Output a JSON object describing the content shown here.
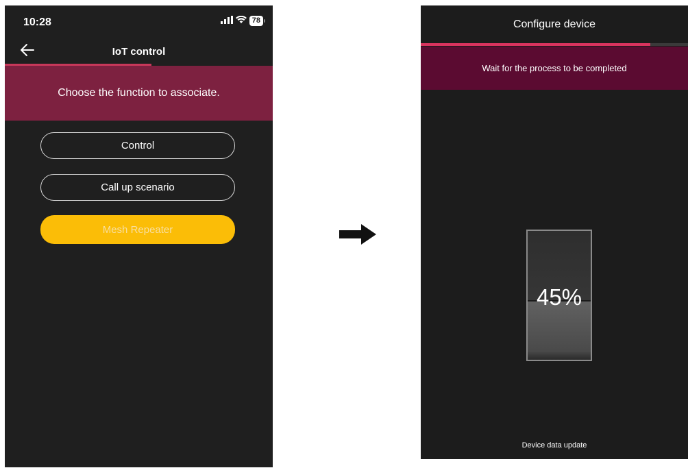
{
  "left_screen": {
    "status_bar": {
      "time": "10:28",
      "signal_icon": "signal-icon",
      "wifi_icon": "wifi-icon",
      "battery": "78"
    },
    "header": {
      "title": "IoT control",
      "back_icon": "arrow-left-icon"
    },
    "banner": {
      "text": "Choose the function to associate."
    },
    "options": [
      {
        "label": "Control"
      },
      {
        "label": "Call up scenario"
      },
      {
        "label": "Mesh Repeater"
      }
    ],
    "colors": {
      "banner": "#7d2140",
      "highlight_button": "#fbbd07",
      "tab_indicator": "#c8385a"
    }
  },
  "arrow": {
    "icon": "arrow-right-icon"
  },
  "right_screen": {
    "header": {
      "title": "Configure device"
    },
    "banner": {
      "text": "Wait for the process to be completed"
    },
    "progress": {
      "percent_text": "45%",
      "value": 0.45
    },
    "top_bar_progress": 0.86,
    "footer": {
      "status_text": "Device data update"
    },
    "colors": {
      "banner": "#5b0b31",
      "accent": "#d9345f"
    }
  }
}
